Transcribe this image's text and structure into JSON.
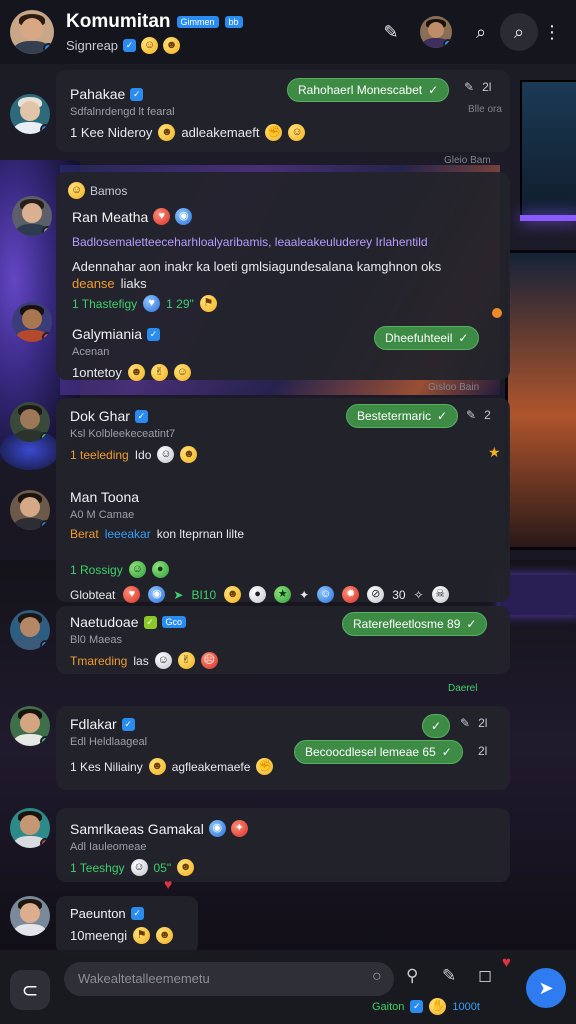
{
  "header": {
    "title": "Komumitan",
    "tag1": "Gimmen",
    "tag2": "bb",
    "subtitle": "Signreap"
  },
  "messages": [
    {
      "name": "Pahakae",
      "meta": "Sdfalnrdengd lt fearal",
      "line": "1 Kee Nideroy",
      "line_tail": "adleakemaeft",
      "pill": "Rahohaerl Monescabet",
      "count": "2l",
      "time": "Blle ora",
      "below": "Gleio Bam"
    },
    {
      "section": "Bamos",
      "name": "Ran Meatha",
      "violet": "Badlosemaletteeceharhloalyaribamis, leaaleakeuluderey Irlahentild",
      "body": "Adennahar aon inakr ka loeti gmlsiagundesalana kamghnon oks",
      "body_orange": "deanse",
      "body_tail": "liaks",
      "green": "1 Thastefigy",
      "green_tail": "1 29\"",
      "name2": "Galymiania",
      "meta2": "Acenan",
      "line2": "1ontetoy",
      "pill": "Dheefuhteeil",
      "below": "Gisloo Bain"
    },
    {
      "name": "Dok Ghar",
      "meta": "Ksl Kolbleekeceatint7",
      "line": "1 teeleding",
      "line_tail": "Ido",
      "pill": "Bestetermaric",
      "count": "2",
      "name2": "Man Toona",
      "meta2": "A0 M Camae",
      "orange": "Berat",
      "blue": "leeeakar",
      "line2_tail": "kon lteprnan lilte",
      "green": "1 Rossigy",
      "reactions": "Globteat",
      "r1": "BI10",
      "r2": "30"
    },
    {
      "name": "Naetudoae",
      "tag": "Gco",
      "meta": "Bl0 Maeas",
      "line": "Tmareding",
      "line_tail": "las",
      "pill": "Raterefleetlosme 89",
      "below": "Daerel"
    },
    {
      "name": "Fdlakar",
      "meta": "Edl Heldlaageal",
      "line": "1 Kes Niliainy",
      "line_tail": "agfleakemaefe",
      "pill_small": "",
      "pill": "Becoocdlesel lemeae 65",
      "count": "2l",
      "count2": "2l"
    },
    {
      "name": "Samrlkaeas Gamakal",
      "meta": "Adl Iauleomeae",
      "line": "1 Teeshgy",
      "line_tail": "05\""
    },
    {
      "name": "Paeunton",
      "line": "10meengi"
    }
  ],
  "composer": {
    "placeholder": "Wakealtetalleememetu",
    "sub1": "Gaiton",
    "sub2": "1000t"
  },
  "icons": [
    "pencil-icon",
    "search-icon",
    "more-icon",
    "pin-icon",
    "check-icon",
    "send-icon",
    "mic-icon",
    "pen-icon",
    "chat-icon"
  ],
  "colors": {
    "accent": "#2f7bf0",
    "pill": "#3d8b45",
    "orange": "#f39b2f",
    "green": "#3ecf6a",
    "violet": "#b89cff"
  }
}
